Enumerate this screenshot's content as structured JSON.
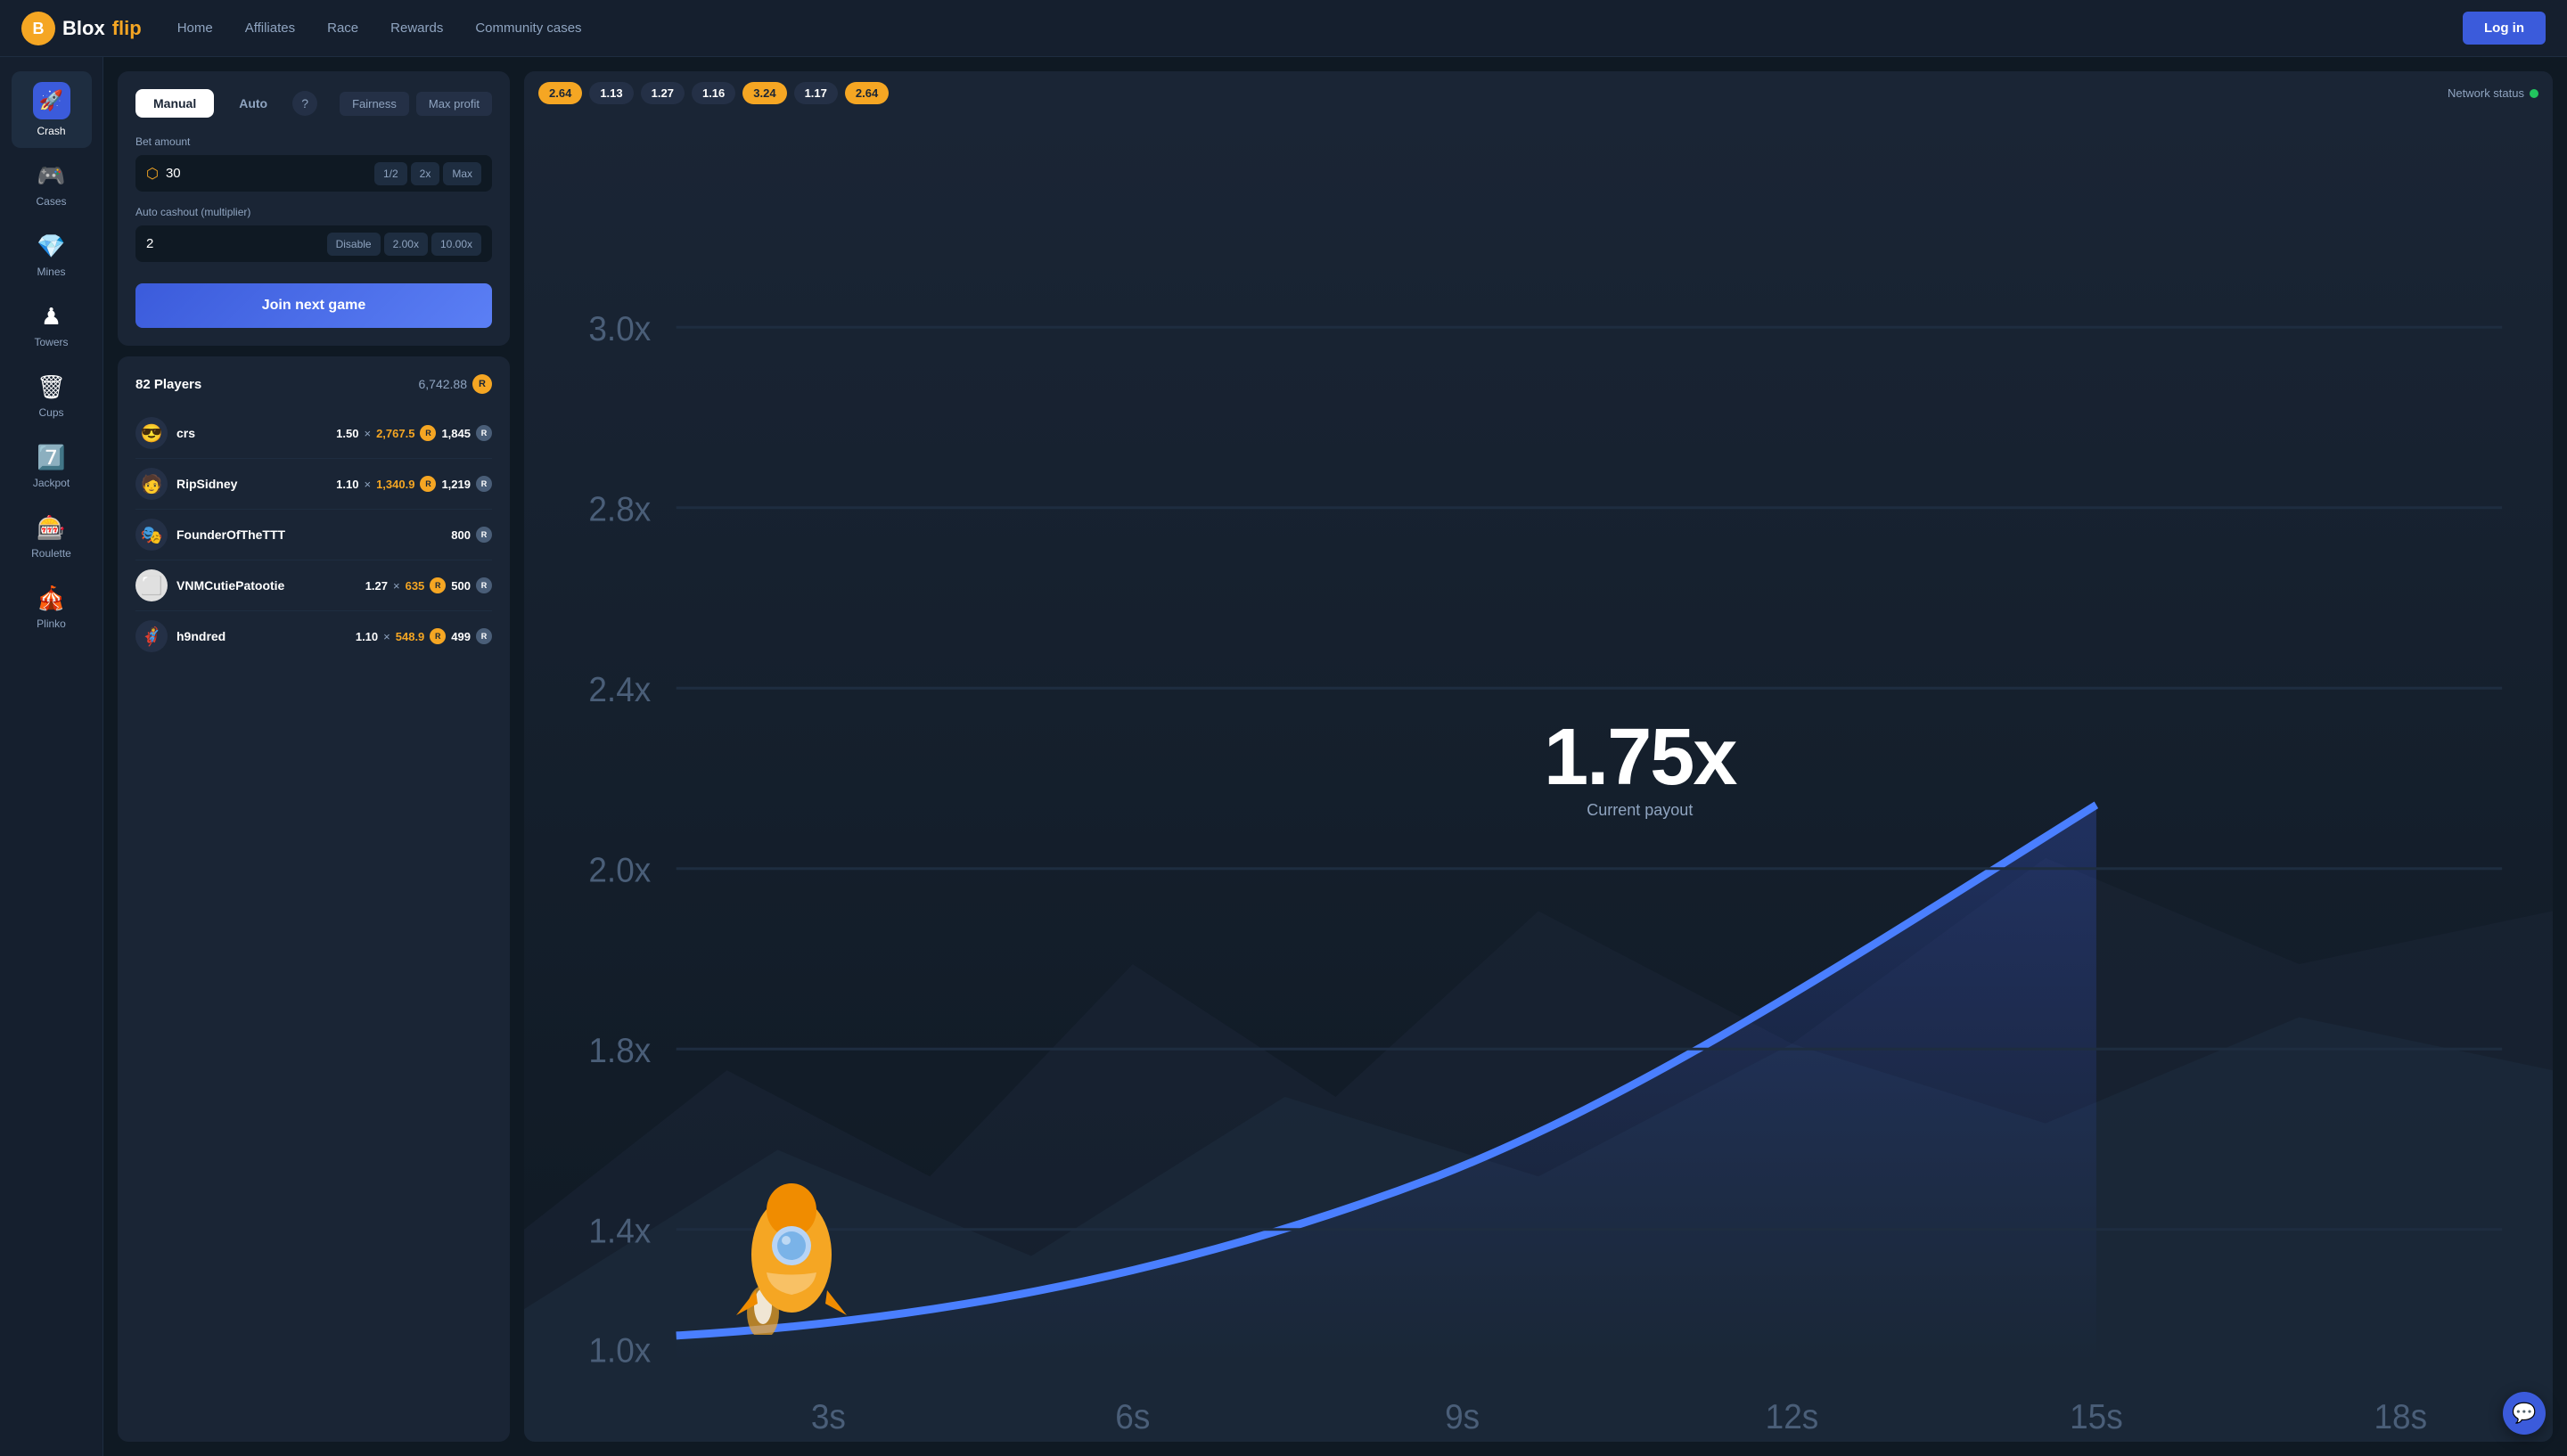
{
  "navbar": {
    "logo_blox": "Blox",
    "logo_flip": "flip",
    "nav_links": [
      {
        "id": "home",
        "label": "Home"
      },
      {
        "id": "affiliates",
        "label": "Affiliates"
      },
      {
        "id": "race",
        "label": "Race"
      },
      {
        "id": "rewards",
        "label": "Rewards"
      },
      {
        "id": "community_cases",
        "label": "Community cases"
      }
    ],
    "login_btn": "Log in"
  },
  "sidebar": {
    "items": [
      {
        "id": "crash",
        "label": "Crash",
        "icon": "🚀",
        "active": true
      },
      {
        "id": "cases",
        "label": "Cases",
        "icon": "🎮"
      },
      {
        "id": "mines",
        "label": "Mines",
        "icon": "💎"
      },
      {
        "id": "towers",
        "label": "Towers",
        "icon": "♟"
      },
      {
        "id": "cups",
        "label": "Cups",
        "icon": "🗑"
      },
      {
        "id": "jackpot",
        "label": "Jackpot",
        "icon": "7️⃣"
      },
      {
        "id": "roulette",
        "label": "Roulette",
        "icon": "🎰"
      },
      {
        "id": "plinko",
        "label": "Plinko",
        "icon": "🎪"
      }
    ]
  },
  "bet_panel": {
    "tab_manual": "Manual",
    "tab_auto": "Auto",
    "help_label": "?",
    "fairness_label": "Fairness",
    "max_profit_label": "Max profit",
    "bet_amount_label": "Bet amount",
    "bet_value": "30",
    "btn_half": "1/2",
    "btn_2x": "2x",
    "btn_max": "Max",
    "autocashout_label": "Auto cashout (multiplier)",
    "autocashout_value": "2",
    "btn_disable": "Disable",
    "btn_2x_cashout": "2.00x",
    "btn_10x_cashout": "10.00x",
    "join_btn": "Join next game"
  },
  "players_panel": {
    "title": "82 Players",
    "total_amount": "6,742.88",
    "players": [
      {
        "name": "crs",
        "avatar": "😎",
        "multiplier": "1.50",
        "cashout": "2,767.5",
        "bet": "1,845",
        "has_cashout": true
      },
      {
        "name": "RipSidney",
        "avatar": "🧑",
        "multiplier": "1.10",
        "cashout": "1,340.9",
        "bet": "1,219",
        "has_cashout": true
      },
      {
        "name": "FounderOfTheTTT",
        "avatar": "🎭",
        "multiplier": null,
        "cashout": null,
        "bet": "800",
        "has_cashout": false
      },
      {
        "name": "VNMCutiePatootie",
        "avatar": "⬜",
        "multiplier": "1.27",
        "cashout": "635",
        "bet": "500",
        "has_cashout": true
      },
      {
        "name": "h9ndred",
        "avatar": "🦸",
        "multiplier": "1.10",
        "cashout": "548.9",
        "bet": "499",
        "has_cashout": true
      }
    ]
  },
  "game": {
    "payout_value": "1.75x",
    "payout_label": "Current payout",
    "network_status_label": "Network status",
    "history": [
      {
        "value": "2.64",
        "type": "orange"
      },
      {
        "value": "1.13",
        "type": "dark"
      },
      {
        "value": "1.27",
        "type": "dark"
      },
      {
        "value": "1.16",
        "type": "dark"
      },
      {
        "value": "3.24",
        "type": "orange"
      },
      {
        "value": "1.17",
        "type": "dark"
      },
      {
        "value": "2.64",
        "type": "orange"
      }
    ],
    "y_labels": [
      "3.0x",
      "2.8x",
      "2.4x",
      "2.0x",
      "1.8x",
      "1.4x",
      "1.0x"
    ],
    "x_labels": [
      "3s",
      "6s",
      "9s",
      "12s",
      "15s",
      "18s"
    ]
  },
  "colors": {
    "accent_orange": "#f5a623",
    "accent_blue": "#3b5bdb",
    "bg_dark": "#0f1923",
    "bg_panel": "#1a2535",
    "text_muted": "#8fa4c0"
  }
}
